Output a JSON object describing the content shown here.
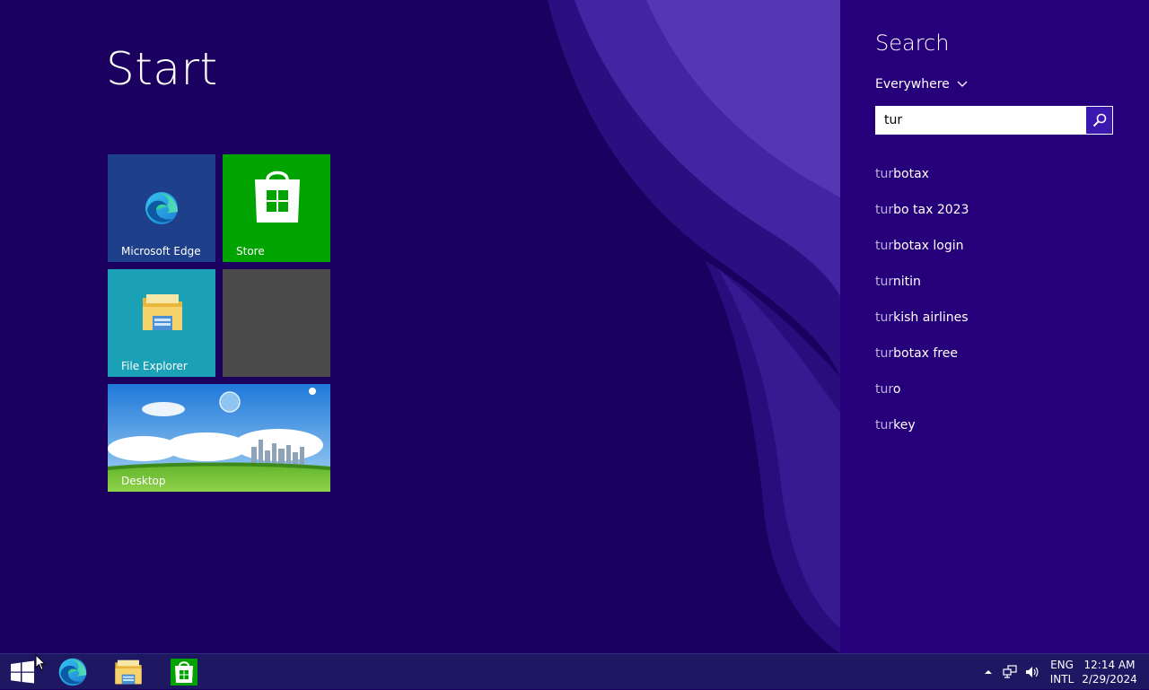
{
  "start": {
    "title": "Start",
    "tiles": [
      {
        "label": "Microsoft Edge",
        "icon": "edge-icon"
      },
      {
        "label": "Store",
        "icon": "store-icon"
      },
      {
        "label": "File Explorer",
        "icon": "folder-icon"
      },
      {
        "label": "",
        "icon": ""
      },
      {
        "label": "Desktop",
        "icon": "desktop-wallpaper"
      }
    ]
  },
  "search": {
    "title": "Search",
    "scope": "Everywhere",
    "query": "tur",
    "suggestions": [
      {
        "match": "tur",
        "rest": "botax"
      },
      {
        "match": "tur",
        "rest": "bo tax 2023"
      },
      {
        "match": "tur",
        "rest": "botax login"
      },
      {
        "match": "tur",
        "rest": "nitin"
      },
      {
        "match": "tur",
        "rest": "kish airlines"
      },
      {
        "match": "tur",
        "rest": "botax free"
      },
      {
        "match": "tur",
        "rest": "o"
      },
      {
        "match": "tur",
        "rest": "key"
      }
    ]
  },
  "taskbar": {
    "language": {
      "line1": "ENG",
      "line2": "INTL"
    },
    "clock": {
      "time": "12:14 AM",
      "date": "2/29/2024"
    }
  },
  "colors": {
    "background": "#1b0060",
    "charm": "#25007a",
    "store_tile": "#00a300",
    "edge_tile": "#1e3f8a",
    "explorer_tile": "#1aa1b5",
    "search_button": "#3d18b0",
    "taskbar": "#1e1863"
  }
}
